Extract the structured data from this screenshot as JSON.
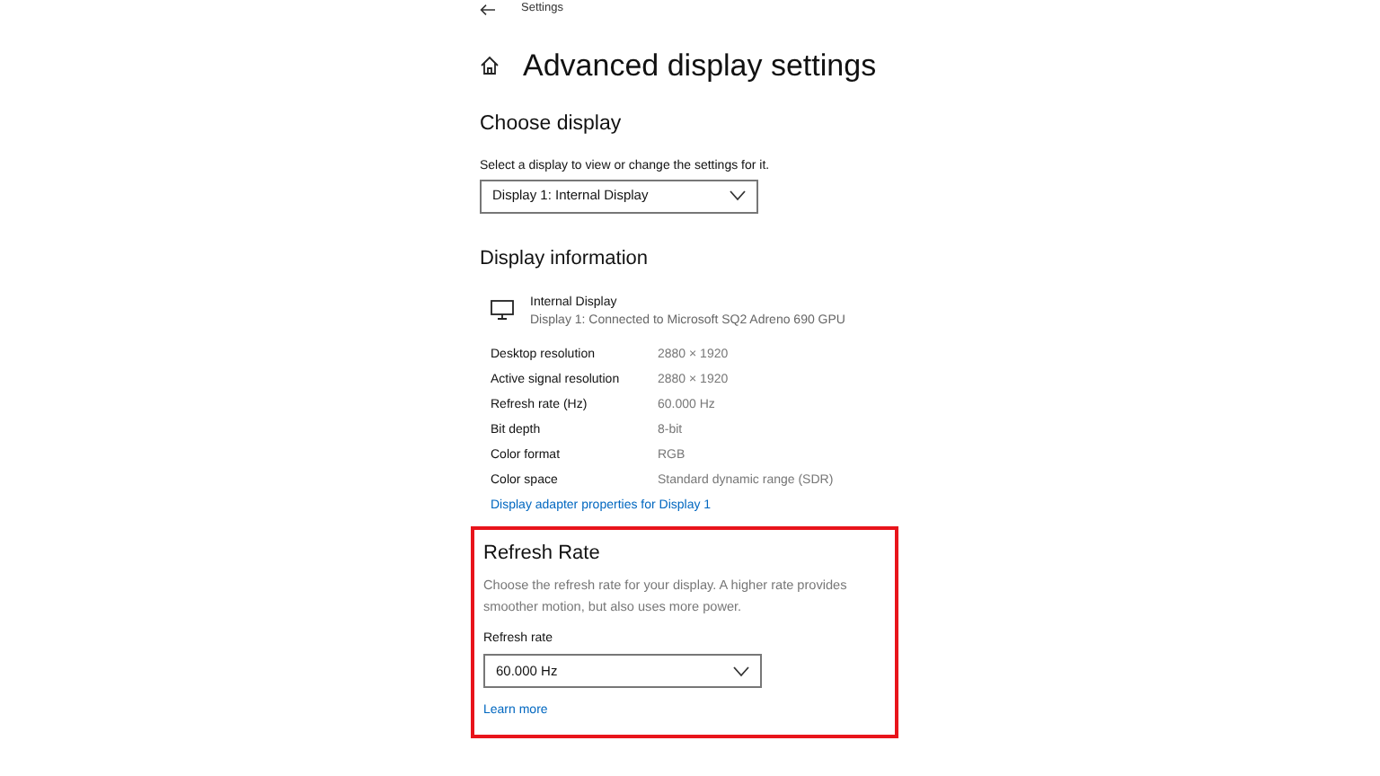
{
  "top_bar": {
    "title": "Settings"
  },
  "page_title": "Advanced display settings",
  "choose_display": {
    "heading": "Choose display",
    "hint": "Select a display to view or change the settings for it.",
    "dropdown": {
      "value": "Display 1: Internal Display"
    }
  },
  "display_information": {
    "heading": "Display information",
    "display_name": "Internal Display",
    "display_detail": "Display 1: Connected to Microsoft SQ2 Adreno 690 GPU",
    "rows": [
      {
        "label": "Desktop resolution",
        "value": "2880 × 1920"
      },
      {
        "label": "Active signal resolution",
        "value": "2880 × 1920"
      },
      {
        "label": "Refresh rate (Hz)",
        "value": "60.000 Hz"
      },
      {
        "label": "Bit depth",
        "value": "8-bit"
      },
      {
        "label": "Color format",
        "value": "RGB"
      },
      {
        "label": "Color space",
        "value": "Standard dynamic range (SDR)"
      }
    ],
    "link": "Display adapter properties for Display 1"
  },
  "refresh_rate": {
    "highlighted": true,
    "heading": "Refresh Rate",
    "description": "Choose the refresh rate for your display. A higher rate provides smoother motion, but also uses more power.",
    "label": "Refresh rate",
    "dropdown": {
      "value": "60.000 Hz"
    },
    "link": "Learn more"
  }
}
